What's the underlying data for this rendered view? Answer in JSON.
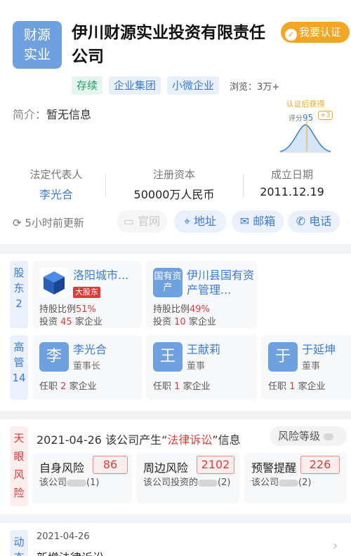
{
  "header": {
    "logo_line1": "财源",
    "logo_line2": "实业",
    "company_name": "伊川财源实业投资有限责任公司",
    "certify_label": "我要认证"
  },
  "tags": [
    "存续",
    "企业集团",
    "小微企业"
  ],
  "views": "浏览：3万+",
  "intro": {
    "label": "简介：",
    "value": "暂无信息"
  },
  "cert_badge": {
    "title": "认证后获得",
    "score_label": "评分",
    "score": "95",
    "plus": "+3"
  },
  "stats": [
    {
      "label": "法定代表人",
      "value": "李光合"
    },
    {
      "label": "注册资本",
      "value": "50000万人民币"
    },
    {
      "label": "成立日期",
      "value": "2011.12.19"
    }
  ],
  "actions": {
    "updated": "5小时前更新",
    "website": "官网",
    "address": "地址",
    "email": "邮箱",
    "phone": "电话"
  },
  "shareholders": {
    "label": "股东",
    "count": "2",
    "items": [
      {
        "name": "洛阳城市...",
        "tag": "大股东",
        "ratio_label": "持股比例",
        "ratio": "51%",
        "invest_prefix": "投资",
        "invest_count": "45",
        "invest_suffix": "家企业"
      },
      {
        "name": "伊川县国有资产管理...",
        "avatar": "国有资产",
        "ratio_label": "持股比例",
        "ratio": "49%",
        "invest_prefix": "投资",
        "invest_count": "10",
        "invest_suffix": "家企业"
      }
    ]
  },
  "executives": {
    "label": "高管",
    "count": "14",
    "items": [
      {
        "avatar": "李",
        "name": "李光合",
        "role": "董事长",
        "prefix": "任职",
        "count": "2",
        "suffix": "家企业"
      },
      {
        "avatar": "王",
        "name": "王献莉",
        "role": "董事",
        "prefix": "任职",
        "count": "1",
        "suffix": "家企业"
      },
      {
        "avatar": "于",
        "name": "于延坤",
        "role": "董事",
        "prefix": "任职",
        "count": "1",
        "suffix": "家企业"
      }
    ]
  },
  "risk": {
    "label": "天眼风险",
    "line_prefix": "2021-04-26 该公司产生“",
    "line_highlight": "法律诉讼",
    "line_suffix": "”信息",
    "level_label": "风险等级",
    "items": [
      {
        "title": "自身风险",
        "count": "86",
        "desc_prefix": "该公司",
        "desc_suffix": "(1)"
      },
      {
        "title": "周边风险",
        "count": "2102",
        "desc_prefix": "该公司投资的",
        "desc_suffix": "(2)"
      },
      {
        "title": "预警提醒",
        "count": "226",
        "desc_prefix": "该公司",
        "desc_suffix": "(2)"
      }
    ]
  },
  "news": {
    "label": "动态",
    "date": "2021-04-26",
    "title": "新增法律诉讼"
  },
  "colors": {
    "accent": "#3b7ad8",
    "warning": "#f4a623",
    "danger": "#e03b3b"
  }
}
